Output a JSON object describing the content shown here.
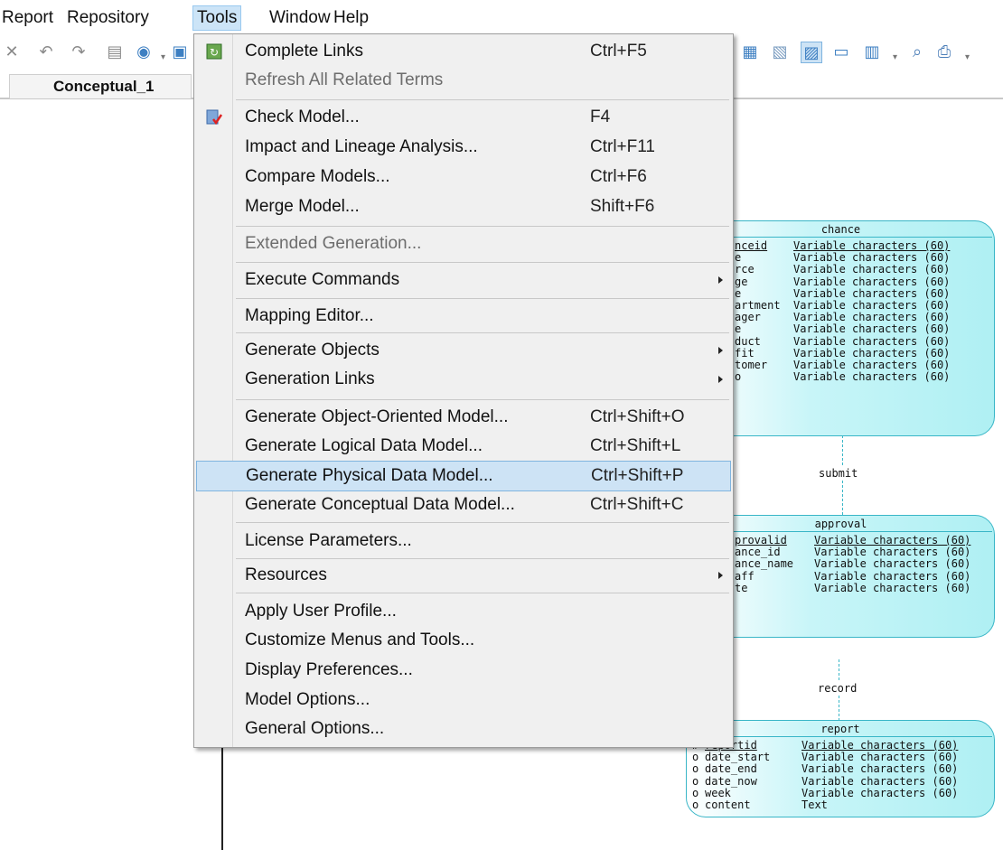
{
  "menubar": {
    "items": [
      "Report",
      "Repository",
      "Tools",
      "Window",
      "Help"
    ],
    "active": "Tools"
  },
  "tab": {
    "label": "Conceptual_1"
  },
  "menu": {
    "items": [
      {
        "label": "Complete Links",
        "shortcut": "Ctrl+F5",
        "icon": "complete-links-icon"
      },
      {
        "label": "Refresh All Related Terms",
        "shortcut": "",
        "disabled": true
      },
      {
        "label": "Check Model...",
        "shortcut": "F4",
        "icon": "check-model-icon"
      },
      {
        "label": "Impact and Lineage Analysis...",
        "shortcut": "Ctrl+F11"
      },
      {
        "label": "Compare Models...",
        "shortcut": "Ctrl+F6"
      },
      {
        "label": "Merge Model...",
        "shortcut": "Shift+F6"
      },
      {
        "label": "Extended Generation...",
        "shortcut": "",
        "disabled": true
      },
      {
        "label": "Execute Commands",
        "shortcut": "",
        "submenu": true
      },
      {
        "label": "Mapping Editor...",
        "shortcut": ""
      },
      {
        "label": "Generate Objects",
        "shortcut": "",
        "submenu": true
      },
      {
        "label": "Generation Links",
        "shortcut": "",
        "submenu": true
      },
      {
        "label": "Generate Object-Oriented Model...",
        "shortcut": "Ctrl+Shift+O"
      },
      {
        "label": "Generate Logical Data Model...",
        "shortcut": "Ctrl+Shift+L"
      },
      {
        "label": "Generate Physical Data Model...",
        "shortcut": "Ctrl+Shift+P",
        "highlighted": true
      },
      {
        "label": "Generate Conceptual Data Model...",
        "shortcut": "Ctrl+Shift+C"
      },
      {
        "label": "License Parameters...",
        "shortcut": ""
      },
      {
        "label": "Resources",
        "shortcut": "",
        "submenu": true
      },
      {
        "label": "Apply User Profile...",
        "shortcut": ""
      },
      {
        "label": "Customize Menus and Tools...",
        "shortcut": ""
      },
      {
        "label": "Display Preferences...",
        "shortcut": ""
      },
      {
        "label": "Model Options...",
        "shortcut": ""
      },
      {
        "label": "General Options...",
        "shortcut": ""
      }
    ]
  },
  "diagram": {
    "entities": [
      {
        "title": "chance",
        "rows": [
          {
            "name": "nceid",
            "type": "Variable characters (60)",
            "key": true
          },
          {
            "name": "e",
            "type": "Variable characters (60)"
          },
          {
            "name": "rce",
            "type": "Variable characters (60)"
          },
          {
            "name": "ge",
            "type": "Variable characters (60)"
          },
          {
            "name": "e",
            "type": "Variable characters (60)"
          },
          {
            "name": "artment",
            "type": "Variable characters (60)"
          },
          {
            "name": "ager",
            "type": "Variable characters (60)"
          },
          {
            "name": "e",
            "type": "Variable characters (60)"
          },
          {
            "name": "duct",
            "type": "Variable characters (60)"
          },
          {
            "name": "fit",
            "type": "Variable characters (60)"
          },
          {
            "name": "tomer",
            "type": "Variable characters (60)"
          },
          {
            "name": "o",
            "type": "Variable characters (60)"
          }
        ]
      },
      {
        "title": "approval",
        "rows": [
          {
            "name": "provalid",
            "type": "Variable characters (60)",
            "key": true
          },
          {
            "name": "ance_id",
            "type": "Variable characters (60)"
          },
          {
            "name": "ance_name",
            "type": "Variable characters (60)"
          },
          {
            "name": "aff",
            "type": "Variable characters (60)"
          },
          {
            "name": "te",
            "type": "Variable characters (60)"
          }
        ]
      },
      {
        "title": "report",
        "rows": [
          {
            "marker": "#",
            "name": "reportid",
            "type": "Variable characters (60)",
            "key": true
          },
          {
            "marker": "o",
            "name": "date_start",
            "type": "Variable characters (60)"
          },
          {
            "marker": "o",
            "name": "date_end",
            "type": "Variable characters (60)"
          },
          {
            "marker": "o",
            "name": "date_now",
            "type": "Variable characters (60)"
          },
          {
            "marker": "o",
            "name": "week",
            "type": "Variable characters (60)"
          },
          {
            "marker": "o",
            "name": "content",
            "type": "Text"
          }
        ]
      }
    ],
    "relationships": [
      "submit",
      "record"
    ]
  }
}
